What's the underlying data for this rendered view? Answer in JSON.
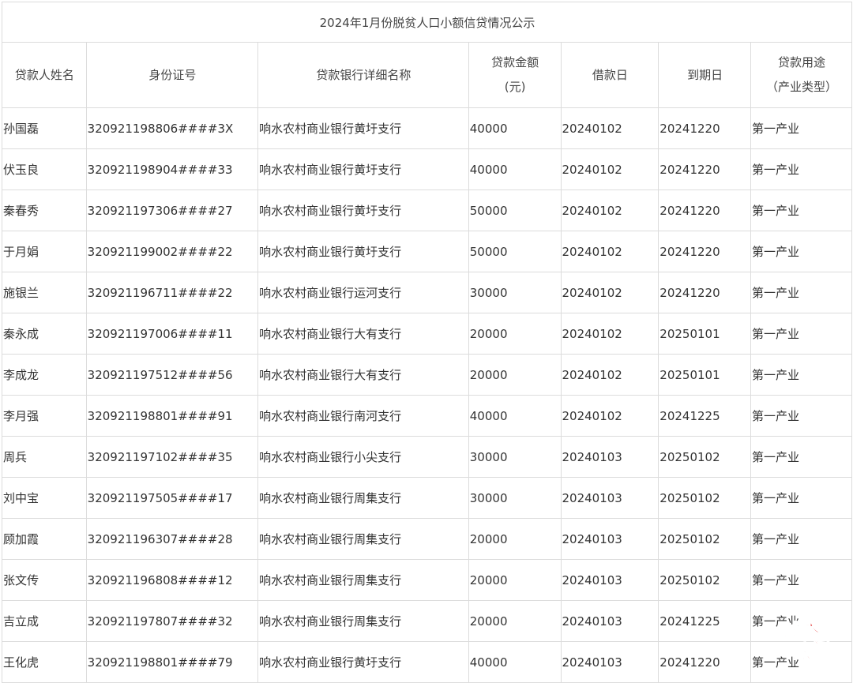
{
  "title": "2024年1月份脱贫人口小额信贷情况公示",
  "headers": {
    "name": "贷款人姓名",
    "id": "身份证号",
    "bank": "贷款银行详细名称",
    "amount_line1": "贷款金额",
    "amount_line2": "(元)",
    "loan_date": "借款日",
    "due_date": "到期日",
    "purpose_line1": "贷款用途",
    "purpose_line2": "（产业类型）"
  },
  "rows": [
    {
      "name": "孙国磊",
      "id": "320921198806####3X",
      "bank": "响水农村商业银行黄圩支行",
      "amount": "40000",
      "loan_date": "20240102",
      "due_date": "20241220",
      "purpose": "第一产业"
    },
    {
      "name": "伏玉良",
      "id": "320921198904####33",
      "bank": "响水农村商业银行黄圩支行",
      "amount": "40000",
      "loan_date": "20240102",
      "due_date": "20241220",
      "purpose": "第一产业"
    },
    {
      "name": "秦春秀",
      "id": "320921197306####27",
      "bank": "响水农村商业银行黄圩支行",
      "amount": "50000",
      "loan_date": "20240102",
      "due_date": "20241220",
      "purpose": "第一产业"
    },
    {
      "name": "于月娟",
      "id": "320921199002####22",
      "bank": "响水农村商业银行黄圩支行",
      "amount": "50000",
      "loan_date": "20240102",
      "due_date": "20241220",
      "purpose": "第一产业"
    },
    {
      "name": "施银兰",
      "id": "320921196711####22",
      "bank": "响水农村商业银行运河支行",
      "amount": "30000",
      "loan_date": "20240102",
      "due_date": "20241220",
      "purpose": "第一产业"
    },
    {
      "name": "秦永成",
      "id": "320921197006####11",
      "bank": "响水农村商业银行大有支行",
      "amount": "20000",
      "loan_date": "20240102",
      "due_date": "20250101",
      "purpose": "第一产业"
    },
    {
      "name": "李成龙",
      "id": "320921197512####56",
      "bank": "响水农村商业银行大有支行",
      "amount": "20000",
      "loan_date": "20240102",
      "due_date": "20250101",
      "purpose": "第一产业"
    },
    {
      "name": "李月强",
      "id": "320921198801####91",
      "bank": "响水农村商业银行南河支行",
      "amount": "40000",
      "loan_date": "20240102",
      "due_date": "20241225",
      "purpose": "第一产业"
    },
    {
      "name": "周兵",
      "id": "320921197102####35",
      "bank": "响水农村商业银行小尖支行",
      "amount": "30000",
      "loan_date": "20240103",
      "due_date": "20250102",
      "purpose": "第一产业"
    },
    {
      "name": "刘中宝",
      "id": "320921197505####17",
      "bank": "响水农村商业银行周集支行",
      "amount": "30000",
      "loan_date": "20240103",
      "due_date": "20250102",
      "purpose": "第一产业"
    },
    {
      "name": "顾加霞",
      "id": "320921196307####28",
      "bank": "响水农村商业银行周集支行",
      "amount": "20000",
      "loan_date": "20240103",
      "due_date": "20250102",
      "purpose": "第一产业"
    },
    {
      "name": "张文传",
      "id": "320921196808####12",
      "bank": "响水农村商业银行周集支行",
      "amount": "20000",
      "loan_date": "20240103",
      "due_date": "20250102",
      "purpose": "第一产业"
    },
    {
      "name": "吉立成",
      "id": "320921197807####32",
      "bank": "响水农村商业银行周集支行",
      "amount": "20000",
      "loan_date": "20240103",
      "due_date": "20241225",
      "purpose": "第一产业"
    },
    {
      "name": "王化虎",
      "id": "320921198801####79",
      "bank": "响水农村商业银行黄圩支行",
      "amount": "40000",
      "loan_date": "20240103",
      "due_date": "20241220",
      "purpose": "第一产业"
    }
  ],
  "watermark": {
    "text": "响水热门",
    "color": "#e02020"
  }
}
